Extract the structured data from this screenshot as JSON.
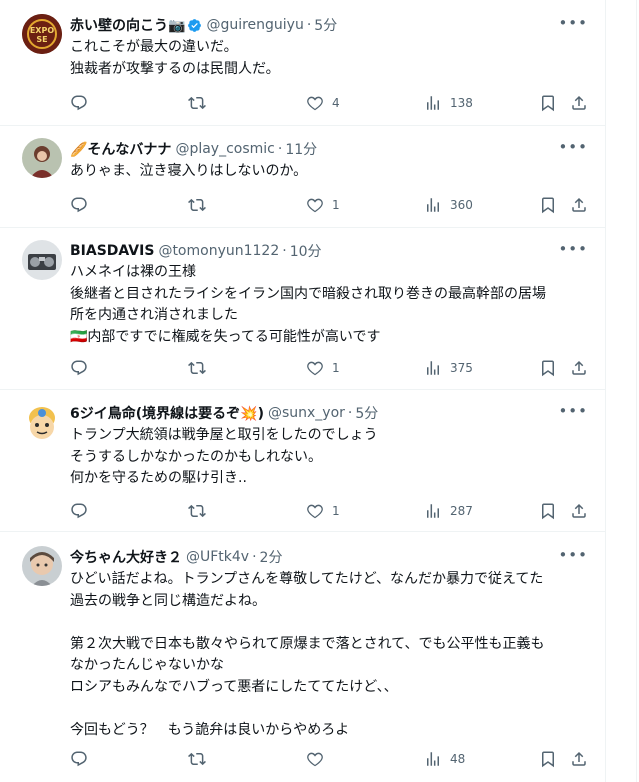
{
  "colors": {
    "accent": "#1d9bf0",
    "muted": "#536471",
    "text": "#0f1419",
    "border": "#eff3f4"
  },
  "tweets": [
    {
      "name": "赤い壁の向こう📷",
      "handle": "@guirenguiyu",
      "sep": "·",
      "time": "5分",
      "verified": true,
      "avatar_text": "EXPO SE",
      "lines": [
        "これこそが最大の違いだ。",
        "独裁者が攻撃するのは民間人だ。"
      ],
      "reply_count": "",
      "retweet_count": "",
      "like_count": "4",
      "view_count": "138"
    },
    {
      "name": "🥖そんなバナナ",
      "handle": "@play_cosmic",
      "sep": "·",
      "time": "11分",
      "verified": false,
      "lines": [
        "ありゃま、泣き寝入りはしないのか。"
      ],
      "reply_count": "",
      "retweet_count": "",
      "like_count": "1",
      "view_count": "360"
    },
    {
      "name": "BIASDAVIS",
      "handle": "@tomonyun1122",
      "sep": "·",
      "time": "10分",
      "verified": false,
      "lines": [
        "ハメネイは裸の王様",
        "後継者と目されたライシをイラン国内で暗殺され取り巻きの最高幹部の居場",
        "所を内通され消されました",
        "🇮🇷内部ですでに権威を失ってる可能性が高いです"
      ],
      "reply_count": "",
      "retweet_count": "",
      "like_count": "1",
      "view_count": "375"
    },
    {
      "name": "6ジイ鳥命(境界線は要るぞ💥)",
      "handle": "@sunx_yor",
      "sep": "·",
      "time": "5分",
      "verified": false,
      "lines": [
        "トランプ大統領は戦争屋と取引をしたのでしょう",
        "そうするしかなかったのかもしれない。",
        "何かを守るための駆け引き.."
      ],
      "reply_count": "",
      "retweet_count": "",
      "like_count": "1",
      "view_count": "287"
    },
    {
      "name": "今ちゃん大好き２",
      "handle": "@UFtk4v",
      "sep": "·",
      "time": "2分",
      "verified": false,
      "lines": [
        "ひどい話だよね。トランプさんを尊敬してたけど、なんだか暴力で従えてた",
        "過去の戦争と同じ構造だよね。",
        "",
        "第２次大戦で日本も散々やられて原爆まで落とされて、でも公平性も正義も",
        "なかったんじゃないかな",
        "ロシアもみんなでハブって悪者にしたててたけど、、",
        "",
        "今回もどう？　もう詭弁は良いからやめろよ"
      ],
      "reply_count": "",
      "retweet_count": "",
      "like_count": "",
      "view_count": "48"
    }
  ]
}
